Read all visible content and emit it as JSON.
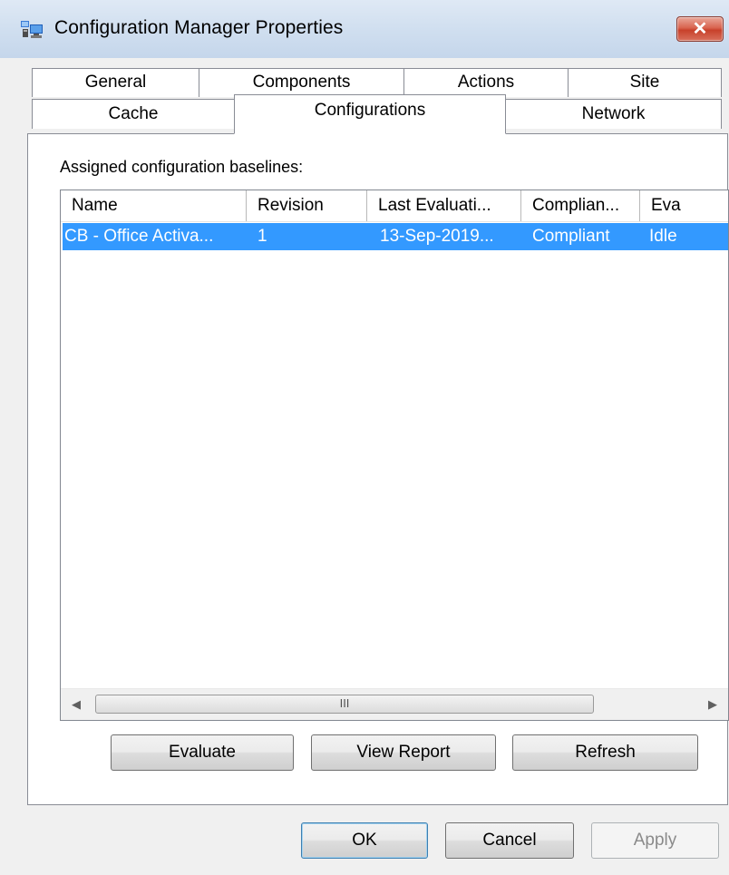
{
  "window": {
    "title": "Configuration Manager Properties",
    "close_glyph": "✕"
  },
  "tabs": {
    "back_row": [
      "General",
      "Components",
      "Actions",
      "Site"
    ],
    "front_row": [
      "Cache",
      "Configurations",
      "Network"
    ],
    "selected": "Configurations"
  },
  "panel": {
    "label": "Assigned configuration baselines:"
  },
  "list": {
    "columns": [
      "Name",
      "Revision",
      "Last Evaluati...",
      "Complian...",
      "Eva"
    ],
    "rows": [
      {
        "name": "CB - Office Activa...",
        "revision": "1",
        "last_evaluation": "13-Sep-2019...",
        "compliance": "Compliant",
        "evaluation": "Idle",
        "selected": true
      }
    ],
    "scrollbar": {
      "left_arrow": "◀",
      "right_arrow": "▶",
      "grip": "III"
    }
  },
  "panel_buttons": {
    "evaluate": "Evaluate",
    "view_report": "View Report",
    "refresh": "Refresh"
  },
  "dialog_buttons": {
    "ok": "OK",
    "cancel": "Cancel",
    "apply": "Apply"
  },
  "colors": {
    "selection": "#3399ff",
    "close_button": "#c8412b"
  }
}
